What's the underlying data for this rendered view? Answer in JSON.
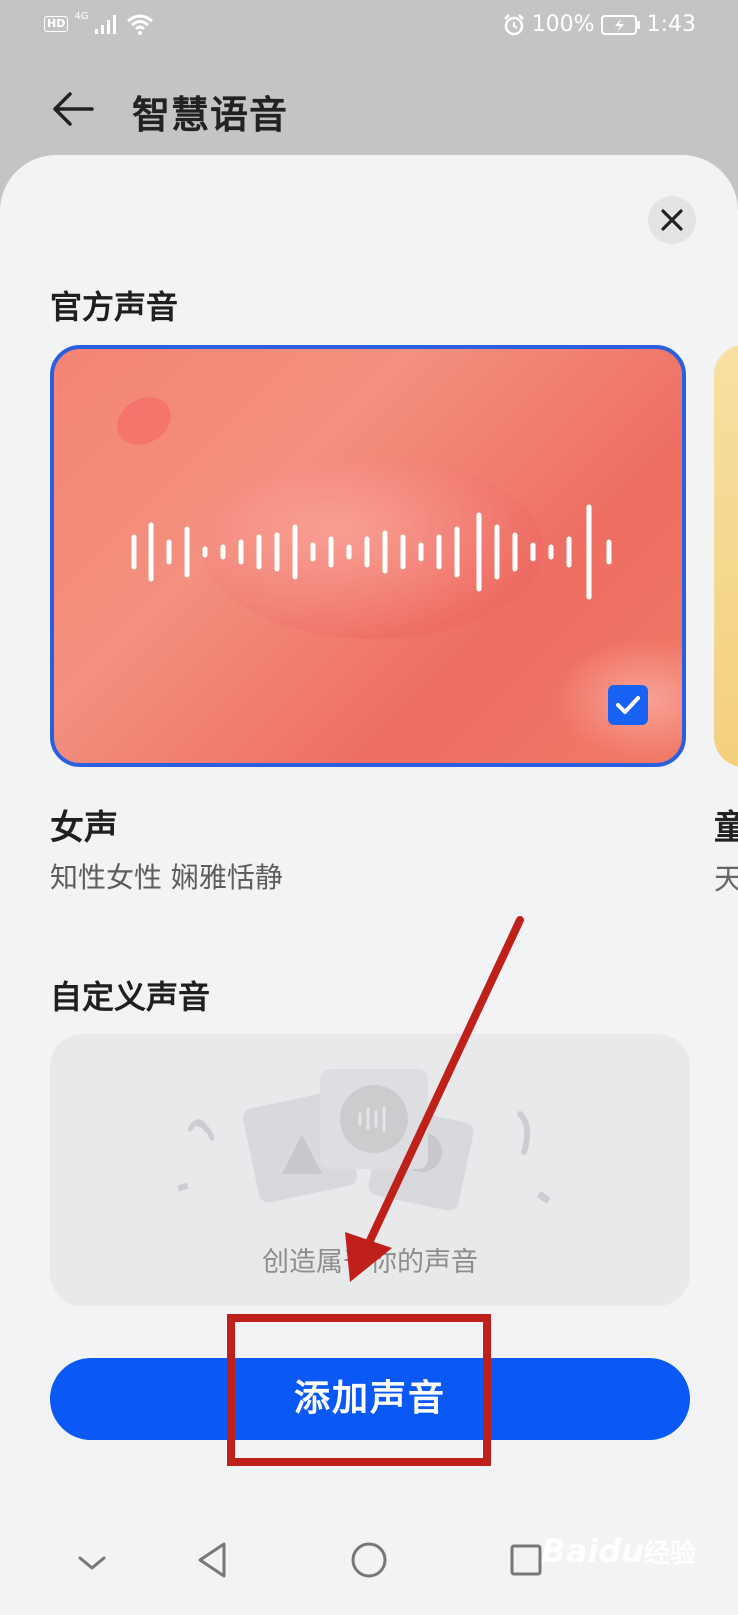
{
  "status_bar": {
    "hd": "HD",
    "network": "4G",
    "battery": "100%",
    "time": "1:43"
  },
  "header": {
    "title": "智慧语音",
    "back_icon": "back-arrow-icon"
  },
  "sheet": {
    "close_icon": "close-icon",
    "official_section_title": "官方声音",
    "official_voices": [
      {
        "name": "女声",
        "description": "知性女性 娴雅恬静",
        "selected": true
      },
      {
        "name": "童",
        "description": "天"
      }
    ],
    "custom_section_title": "自定义声音",
    "custom_empty_hint": "创造属于你的声音",
    "add_button_label": "添加声音"
  },
  "nav_bar": {
    "icons": [
      "collapse-icon",
      "back-triangle-icon",
      "home-circle-icon",
      "recents-square-icon"
    ]
  },
  "watermark": {
    "brand": "Baidu",
    "suffix": "经验"
  },
  "colors": {
    "accent": "#0a59f7",
    "annotation_red": "#c0201a",
    "selection_border": "#2b5fe0"
  }
}
